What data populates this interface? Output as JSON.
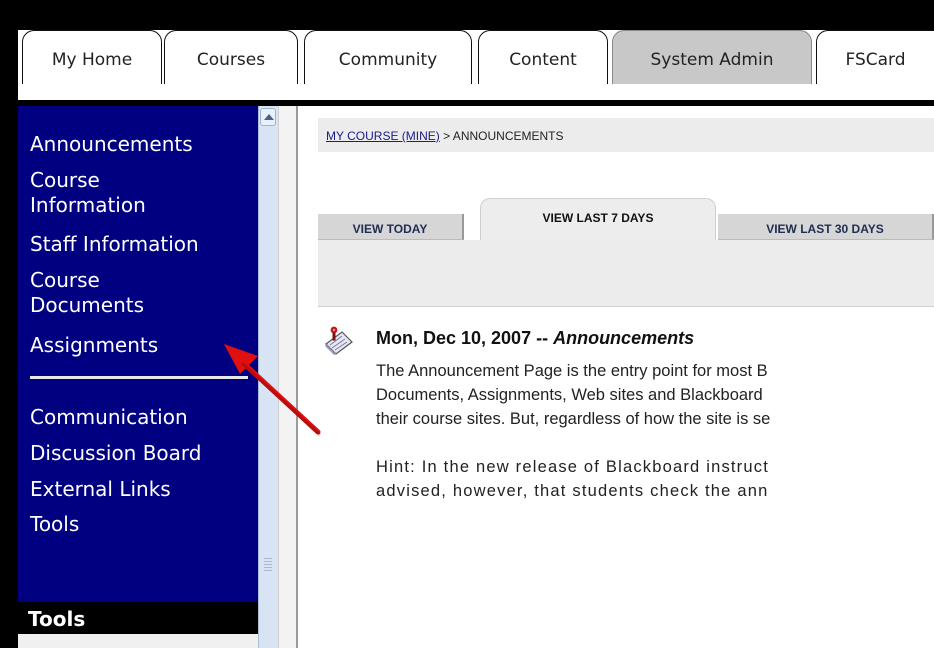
{
  "top_tabs": [
    {
      "label": "My Home"
    },
    {
      "label": "Courses"
    },
    {
      "label": "Community"
    },
    {
      "label": "Content"
    },
    {
      "label": "System Admin"
    },
    {
      "label": "FSCard"
    }
  ],
  "sidebar": {
    "items": [
      {
        "label": "Announcements"
      },
      {
        "label": "Course\nInformation"
      },
      {
        "label": "Staff Information"
      },
      {
        "label": "Course\nDocuments"
      },
      {
        "label": "Assignments"
      },
      {
        "label": "Communication"
      },
      {
        "label": "Discussion Board"
      },
      {
        "label": "External Links"
      },
      {
        "label": "Tools"
      }
    ],
    "tools_header": "Tools"
  },
  "breadcrumb": {
    "course_link": "MY COURSE (MINE)",
    "current": " > ANNOUNCEMENTS"
  },
  "view_tabs": [
    {
      "label": "VIEW TODAY",
      "active": false
    },
    {
      "label": "VIEW LAST 7 DAYS",
      "active": true
    },
    {
      "label": "VIEW LAST 30 DAYS",
      "active": false
    }
  ],
  "announcement": {
    "date": "Mon, Dec 10, 2007",
    "separator": " -- ",
    "category": "Announcements",
    "body_lines": [
      "The Announcement Page is the entry point for most B",
      "Documents, Assignments, Web sites and Blackboard",
      "their course sites. But, regardless of how the site is se"
    ],
    "hint_lines": [
      "Hint: In the new release of Blackboard instruct",
      "advised, however, that students check the ann"
    ]
  },
  "colors": {
    "sidebar_bg": "#000080",
    "arrow": "#e01010"
  }
}
